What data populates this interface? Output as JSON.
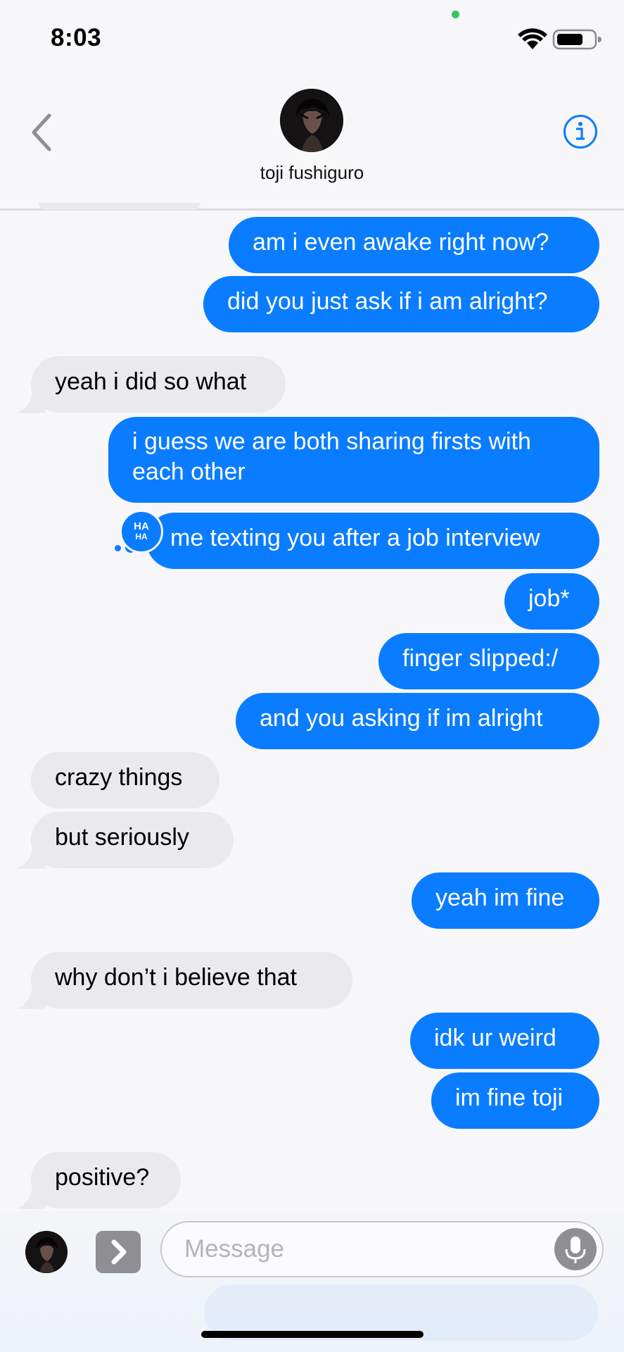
{
  "status_bar": {
    "time": "8:03",
    "icons": [
      "wifi-icon",
      "battery-icon"
    ]
  },
  "header": {
    "contact_name": "toji fushiguro",
    "back_icon": "chevron-left-icon",
    "info_icon": "info-icon"
  },
  "messages": [
    {
      "from": "me",
      "text": "am i even awake right now?"
    },
    {
      "from": "me",
      "text": "did you just ask if i am alright?"
    },
    {
      "from": "them",
      "text": "yeah i did so what"
    },
    {
      "from": "me",
      "text": "i guess we are both sharing firsts with each other"
    },
    {
      "from": "me",
      "text": "me texting you after a job interview",
      "tapback": "HA HA"
    },
    {
      "from": "me",
      "text": "job*"
    },
    {
      "from": "me",
      "text": "finger slipped:/"
    },
    {
      "from": "me",
      "text": "and you asking if im alright"
    },
    {
      "from": "them",
      "text": "crazy things"
    },
    {
      "from": "them",
      "text": "but seriously"
    },
    {
      "from": "me",
      "text": "yeah im fine"
    },
    {
      "from": "them",
      "text": "why don’t i believe that"
    },
    {
      "from": "me",
      "text": "idk ur weird"
    },
    {
      "from": "me",
      "text": "im fine toji"
    },
    {
      "from": "them",
      "text": "positive?"
    }
  ],
  "tapback": {
    "line1": "HA",
    "line2": "HA"
  },
  "input": {
    "placeholder": "Message",
    "apps_icon": "chevron-right-icon",
    "mic_icon": "microphone-icon"
  },
  "colors": {
    "sent_bubble": "#0a7cff",
    "received_bubble": "#e9e9ee",
    "background": "#f7f7f9"
  }
}
